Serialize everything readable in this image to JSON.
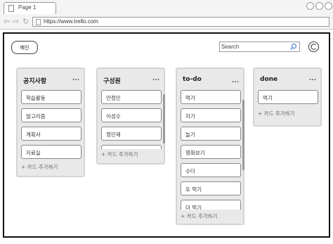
{
  "browser": {
    "tab_title": "Page 1",
    "url": "https://www.trello.com"
  },
  "header": {
    "button_label": "메인",
    "search_placeholder": "Search",
    "icons": [
      "search-icon",
      "refresh-icon"
    ]
  },
  "board": {
    "lists": [
      {
        "title": "공지사항",
        "menu": "...",
        "cards": [
          "학습활동",
          "알고리즘",
          "계획서",
          "자료실"
        ],
        "add_card": "+ 카드 추가하기"
      },
      {
        "title": "구성원",
        "menu": "...",
        "cards": [
          "안정민",
          "이성수",
          "정민재"
        ],
        "add_card": "+ 카드 추가하기"
      },
      {
        "title": "to-do",
        "menu": "...",
        "cards": [
          "먹기",
          "자기",
          "놀기",
          "영화보기",
          "수다",
          "또 먹기",
          "더 먹기"
        ],
        "add_card": "+ 카드 추가하기"
      },
      {
        "title": "done",
        "menu": "...",
        "cards": [
          "먹기"
        ],
        "add_card": "+ 카드 추가하기"
      }
    ]
  }
}
